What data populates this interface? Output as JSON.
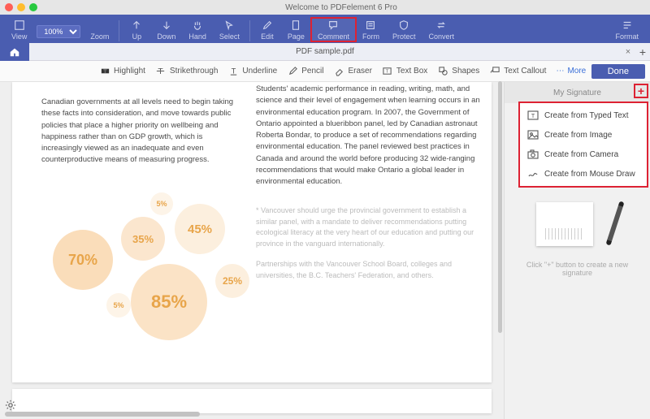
{
  "window": {
    "title": "Welcome to PDFelement 6 Pro"
  },
  "main_toolbar": {
    "view": "View",
    "zoom_label": "Zoom",
    "zoom_value": "100%",
    "up": "Up",
    "down": "Down",
    "hand": "Hand",
    "select": "Select",
    "edit": "Edit",
    "page": "Page",
    "comment": "Comment",
    "form": "Form",
    "protect": "Protect",
    "convert": "Convert",
    "format": "Format"
  },
  "tab": {
    "filename": "PDF sample.pdf",
    "close": "×",
    "add": "+"
  },
  "subtoolbar": {
    "highlight": "Highlight",
    "strikethrough": "Strikethrough",
    "underline": "Underline",
    "pencil": "Pencil",
    "eraser": "Eraser",
    "textbox": "Text Box",
    "shapes": "Shapes",
    "textcallout": "Text Callout",
    "more": "More",
    "done": "Done"
  },
  "document": {
    "col1_para": "Canadian governments at all levels need to begin taking these facts into consideration, and move towards public policies that place a higher priority on wellbeing and happiness rather than on GDP growth, which is increasingly viewed as an inadequate and even counterproductive means of measuring progress.",
    "col2_para": "Students' academic performance in reading, writing, math, and science and their level of engagement when learning occurs in an environmental education program. In 2007, the Government of Ontario appointed a blueribbon panel, led by Canadian astronaut Roberta Bondar, to produce a set of recommendations regarding environmental education. The panel reviewed best practices in Canada and around the world before producing 32 wide-ranging recommendations that would make Ontario a global leader in environmental education.",
    "foot_p1": "* Vancouver should urge the provincial government to establish a similar panel, with a mandate to deliver recommendations putting ecological literacy at the very heart of our education and putting our province in the vanguard internationally.",
    "foot_p2": "Partnerships with the Vancouver School Board, colleges and universities, the B.C. Teachers' Federation, and others."
  },
  "chart_data": {
    "type": "bubble",
    "title": "",
    "series": [
      {
        "label": "70%",
        "value": 70
      },
      {
        "label": "35%",
        "value": 35
      },
      {
        "label": "45%",
        "value": 45
      },
      {
        "label": "5%",
        "value": 5
      },
      {
        "label": "85%",
        "value": 85
      },
      {
        "label": "5%",
        "value": 5
      },
      {
        "label": "25%",
        "value": 25
      }
    ]
  },
  "signature_panel": {
    "tab_label": "My Signature",
    "add": "+",
    "menu": {
      "typed": "Create from Typed Text",
      "image": "Create from Image",
      "camera": "Create from Camera",
      "mouse": "Create from Mouse Draw"
    },
    "hint": "Click \"+\" button to create a new signature"
  }
}
